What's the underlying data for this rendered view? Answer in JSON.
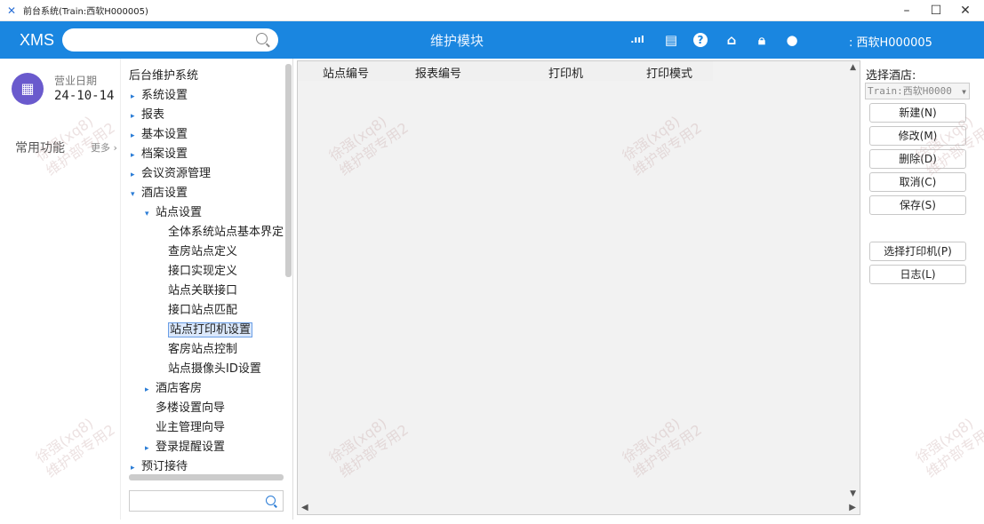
{
  "window": {
    "title": "前台系统(Train:西软H000005)",
    "controls": {
      "minimize": "–",
      "maximize": "☐",
      "close": "✕"
    }
  },
  "topbar": {
    "brand": "XMS",
    "search_placeholder": "",
    "module_title": "维护模块",
    "user": ": 西软H000005",
    "icons": [
      "signal-icon",
      "clipboard-icon",
      "help-icon",
      "home-icon",
      "lock-icon",
      "user-icon"
    ]
  },
  "left": {
    "date_label": "营业日期",
    "date_value": "24-10-14",
    "common_label": "常用功能",
    "more_label": "更多 ›"
  },
  "tree": {
    "items": [
      {
        "label": "后台维护系统",
        "arrow": ""
      },
      {
        "label": "系统设置",
        "arrow": "▸"
      },
      {
        "label": "报表",
        "arrow": "▸"
      },
      {
        "label": "基本设置",
        "arrow": "▸"
      },
      {
        "label": "档案设置",
        "arrow": "▸"
      },
      {
        "label": "会议资源管理",
        "arrow": "▸"
      },
      {
        "label": "酒店设置",
        "arrow": "▾"
      },
      {
        "label": "站点设置",
        "arrow": "▾"
      },
      {
        "label": "全体系统站点基本界定",
        "arrow": ""
      },
      {
        "label": "查房站点定义",
        "arrow": ""
      },
      {
        "label": "接口实现定义",
        "arrow": ""
      },
      {
        "label": "站点关联接口",
        "arrow": ""
      },
      {
        "label": "接口站点匹配",
        "arrow": ""
      },
      {
        "label": "站点打印机设置",
        "arrow": ""
      },
      {
        "label": "客房站点控制",
        "arrow": ""
      },
      {
        "label": "站点摄像头ID设置",
        "arrow": ""
      },
      {
        "label": "酒店客房",
        "arrow": "▸"
      },
      {
        "label": "多楼设置向导",
        "arrow": ""
      },
      {
        "label": "业主管理向导",
        "arrow": ""
      },
      {
        "label": "登录提醒设置",
        "arrow": "▸"
      },
      {
        "label": "预订接待",
        "arrow": "▸"
      }
    ],
    "search_value": ""
  },
  "grid": {
    "columns": [
      "站点编号",
      "报表编号",
      "打印机",
      "打印模式"
    ]
  },
  "right": {
    "hotel_label": "选择酒店:",
    "hotel_value": "Train:西软H0000",
    "buttons": {
      "new": "新建(N)",
      "edit": "修改(M)",
      "delete": "删除(D)",
      "cancel": "取消(C)",
      "save": "保存(S)",
      "select_printer": "选择打印机(P)",
      "log": "日志(L)"
    }
  },
  "watermark": {
    "line1": "徐强(xq8)",
    "line2": "维护部专用2"
  },
  "colors": {
    "accent": "#1a86e0",
    "selection": "#dbe8fb"
  }
}
